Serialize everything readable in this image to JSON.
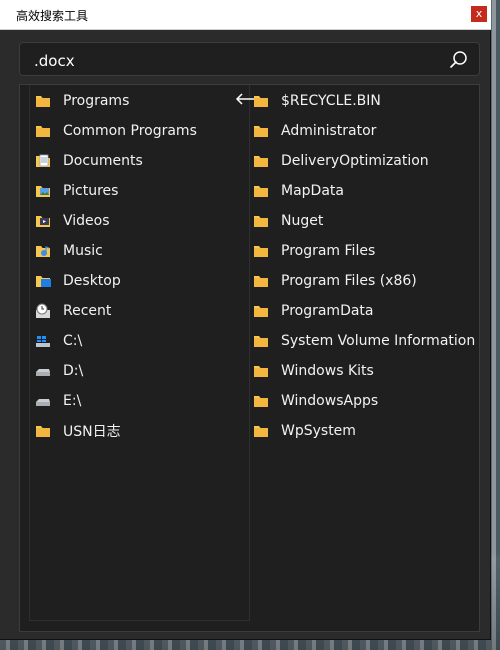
{
  "window": {
    "title": "高效搜索工具",
    "close_glyph": "x"
  },
  "search": {
    "value": ".docx",
    "icon": "search-icon"
  },
  "left_items": [
    {
      "label": "Programs",
      "icon": "folder-icon"
    },
    {
      "label": "Common Programs",
      "icon": "folder-icon"
    },
    {
      "label": "Documents",
      "icon": "documents-folder-icon"
    },
    {
      "label": "Pictures",
      "icon": "pictures-folder-icon"
    },
    {
      "label": "Videos",
      "icon": "videos-folder-icon"
    },
    {
      "label": "Music",
      "icon": "music-folder-icon"
    },
    {
      "label": "Desktop",
      "icon": "desktop-folder-icon"
    },
    {
      "label": "Recent",
      "icon": "recent-icon"
    },
    {
      "label": "C:\\",
      "icon": "windows-drive-icon"
    },
    {
      "label": "D:\\",
      "icon": "drive-icon"
    },
    {
      "label": "E:\\",
      "icon": "drive-icon"
    },
    {
      "label": "USN日志",
      "icon": "folder-icon"
    }
  ],
  "arrow": {
    "glyph": "←"
  },
  "right_items": [
    {
      "label": "$RECYCLE.BIN"
    },
    {
      "label": "Administrator"
    },
    {
      "label": "DeliveryOptimization"
    },
    {
      "label": "MapData"
    },
    {
      "label": "Nuget"
    },
    {
      "label": "Program Files"
    },
    {
      "label": "Program Files (x86)"
    },
    {
      "label": "ProgramData"
    },
    {
      "label": "System Volume Information"
    },
    {
      "label": "Windows Kits"
    },
    {
      "label": "WindowsApps"
    },
    {
      "label": "WpSystem"
    }
  ],
  "colors": {
    "background": "#2b2b2b",
    "panel": "#1f1f1f",
    "text": "#f2f2f2",
    "folder": "#f7c84f",
    "close": "#c42b1c"
  }
}
